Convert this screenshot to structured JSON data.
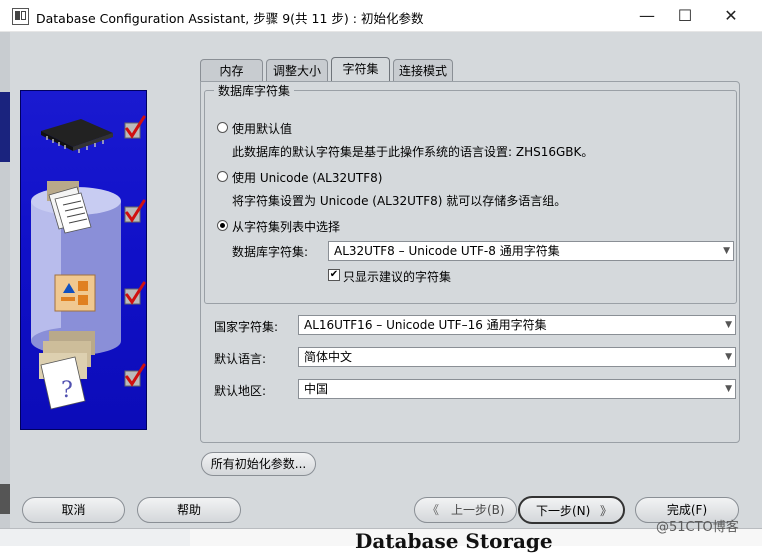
{
  "window": {
    "title": "Database Configuration Assistant, 步骤 9(共 11 步) : 初始化参数",
    "minimize": "—",
    "maximize": "☐",
    "close": "✕"
  },
  "tabs": [
    {
      "label": "内存"
    },
    {
      "label": "调整大小"
    },
    {
      "label": "字符集",
      "active": true
    },
    {
      "label": "连接模式"
    }
  ],
  "db_charset": {
    "group_label": "数据库字符集",
    "options": [
      {
        "label": "使用默认值",
        "desc": "此数据库的默认字符集是基于此操作系统的语言设置: ZHS16GBK。",
        "selected": false
      },
      {
        "label": "使用 Unicode (AL32UTF8)",
        "desc": "将字符集设置为 Unicode (AL32UTF8) 就可以存储多语言组。",
        "selected": false
      },
      {
        "label": "从字符集列表中选择",
        "selected": true
      }
    ],
    "select_label": "数据库字符集:",
    "select_value": "AL32UTF8 – Unicode UTF-8 通用字符集",
    "checkbox_label": "只显示建议的字符集",
    "checkbox_checked": true
  },
  "fields": {
    "national_label": "国家字符集:",
    "national_value": "AL16UTF16 – Unicode UTF–16 通用字符集",
    "language_label": "默认语言:",
    "language_value": "简体中文",
    "territory_label": "默认地区:",
    "territory_value": "中国"
  },
  "all_params_button": "所有初始化参数...",
  "buttons": {
    "cancel": "取消",
    "help": "帮助",
    "back": "上一步(B)",
    "next": "下一步(N)",
    "finish": "完成(F)"
  },
  "background_text": "Database Storage",
  "watermark": "@51CTO博客",
  "colors": {
    "panel_bg": "#d5d9dc",
    "image_blue": "#1010c8",
    "check_red": "#d01010"
  }
}
